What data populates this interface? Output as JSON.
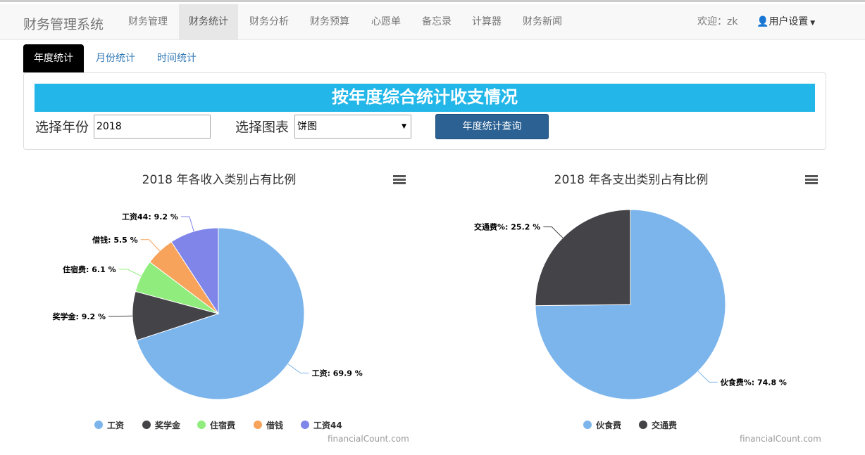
{
  "nav": {
    "brand": "财务管理系统",
    "items": [
      "财务管理",
      "财务统计",
      "财务分析",
      "财务预算",
      "心愿单",
      "备忘录",
      "计算器",
      "财务新闻"
    ],
    "active": 1,
    "welcome": "欢迎：zk",
    "user_settings": "用户设置"
  },
  "tabs": [
    "年度统计",
    "月份统计",
    "时间统计"
  ],
  "panel": {
    "banner": "按年度综合统计收支情况",
    "year_label": "选择年份",
    "year_value": "2018",
    "chart_label": "选择图表",
    "chart_value": "饼图",
    "query_button": "年度统计查询"
  },
  "chart_data": [
    {
      "type": "pie",
      "title": "2018 年各收入类别占有比例",
      "credit": "financialCount.com",
      "slices": [
        {
          "name": "工资",
          "value": 69.9,
          "label": "工资: 69.9 %",
          "color": "#7cb5ec"
        },
        {
          "name": "奖学金",
          "value": 9.2,
          "label": "奖学金: 9.2 %",
          "color": "#434348"
        },
        {
          "name": "住宿费",
          "value": 6.1,
          "label": "住宿费: 6.1 %",
          "color": "#90ed7d"
        },
        {
          "name": "借钱",
          "value": 5.5,
          "label": "借钱: 5.5 %",
          "color": "#f7a35c"
        },
        {
          "name": "工资44",
          "value": 9.2,
          "label": "工资44: 9.2 %",
          "color": "#8085e9"
        }
      ]
    },
    {
      "type": "pie",
      "title": "2018 年各支出类别占有比例",
      "credit": "financialCount.com",
      "slices": [
        {
          "name": "伙食费",
          "value": 74.8,
          "label": "伙食费%: 74.8 %",
          "color": "#7cb5ec"
        },
        {
          "name": "交通费",
          "value": 25.2,
          "label": "交通费%: 25.2 %",
          "color": "#434348"
        }
      ]
    }
  ]
}
